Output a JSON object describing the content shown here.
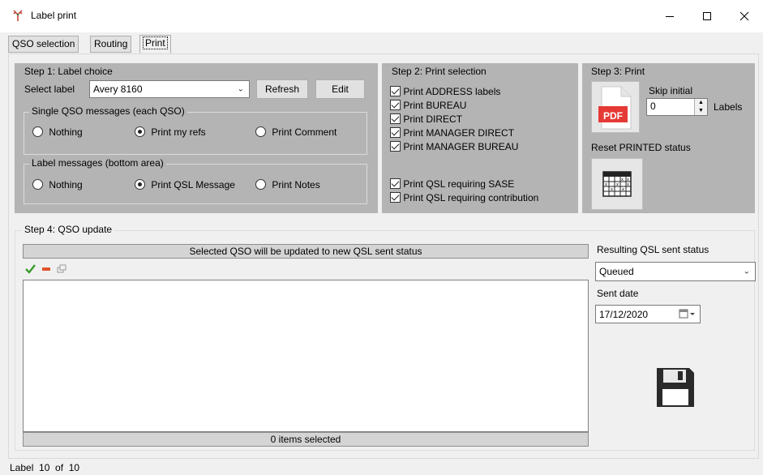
{
  "window": {
    "title": "Label print"
  },
  "tabs": [
    {
      "label": "QSO selection"
    },
    {
      "label": "Routing"
    },
    {
      "label": "Print"
    }
  ],
  "step1": {
    "title": "Step 1: Label choice",
    "select_label_caption": "Select label",
    "select_label_value": "Avery 8160",
    "refresh_label": "Refresh",
    "edit_label": "Edit",
    "single_group_title": "Single QSO messages (each QSO)",
    "single_options": [
      {
        "label": "Nothing",
        "selected": false
      },
      {
        "label": "Print my refs",
        "selected": true
      },
      {
        "label": "Print Comment",
        "selected": false
      }
    ],
    "label_group_title": "Label messages (bottom area)",
    "label_options": [
      {
        "label": "Nothing",
        "selected": false
      },
      {
        "label": "Print QSL Message",
        "selected": true
      },
      {
        "label": "Print Notes",
        "selected": false
      }
    ]
  },
  "step2": {
    "title": "Step 2: Print selection",
    "checks": [
      {
        "label": "Print ADDRESS labels",
        "checked": true
      },
      {
        "label": "Print BUREAU",
        "checked": true
      },
      {
        "label": "Print DIRECT",
        "checked": true
      },
      {
        "label": "Print MANAGER DIRECT",
        "checked": true
      },
      {
        "label": "Print MANAGER BUREAU",
        "checked": true
      }
    ],
    "checks2": [
      {
        "label": "Print QSL requiring SASE",
        "checked": true
      },
      {
        "label": "Print QSL requiring contribution",
        "checked": true
      }
    ]
  },
  "step3": {
    "title": "Step 3: Print",
    "pdf_text": "PDF",
    "skip_initial_label": "Skip initial",
    "skip_value": "0",
    "labels_suffix": "Labels",
    "reset_label": "Reset PRINTED status"
  },
  "step4": {
    "title": "Step 4: QSO update",
    "banner": "Selected QSO will be updated to new QSL sent status",
    "items_selected": "0 items selected",
    "resulting_label": "Resulting QSL sent status",
    "resulting_value": "Queued",
    "sent_date_label": "Sent date",
    "sent_date_value": "17/12/2020"
  },
  "statusbar": {
    "text": "Label  10  of  10"
  }
}
